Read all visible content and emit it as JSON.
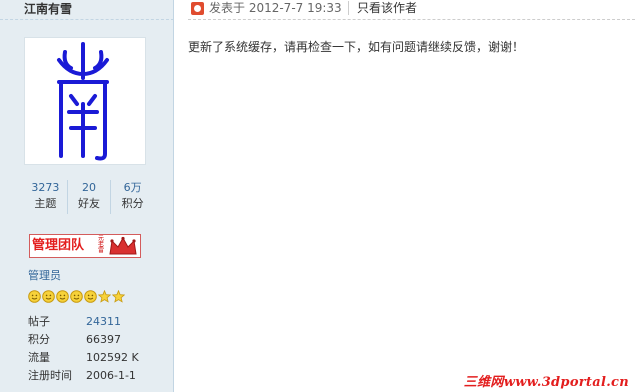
{
  "author": {
    "name": "江南有雪",
    "avatar_icon": "seal-glyph-avatar",
    "stats": [
      {
        "value": "3273",
        "label": "主题"
      },
      {
        "value": "20",
        "label": "好友"
      },
      {
        "value": "6万",
        "label": "积分"
      }
    ],
    "group_badge": "管理团队",
    "group_badge_tag": "元\n老\n雷",
    "role": "管理员",
    "star_icons": [
      "sun-icon",
      "sun-icon",
      "sun-icon",
      "sun-icon",
      "sun-icon",
      "star-icon",
      "star-icon"
    ],
    "info": [
      {
        "key": "帖子",
        "value": "24311",
        "link": true
      },
      {
        "key": "积分",
        "value": "66397",
        "link": false
      },
      {
        "key": "流量",
        "value": "102592 K",
        "link": false
      },
      {
        "key": "注册时间",
        "value": "2006-1-1",
        "link": false
      }
    ]
  },
  "post": {
    "time": "发表于  2012-7-7 19:33",
    "only_author": "只看该作者",
    "body": "更新了系统缓存，请再检查一下，如有问题请继续反馈，谢谢！"
  },
  "watermark": "三维网www.3dportal.cn",
  "colors": {
    "sidebar_bg": "#e5edf2",
    "link": "#336699",
    "badge_red": "#e31e1e",
    "seal_blue": "#1a1ad6"
  }
}
